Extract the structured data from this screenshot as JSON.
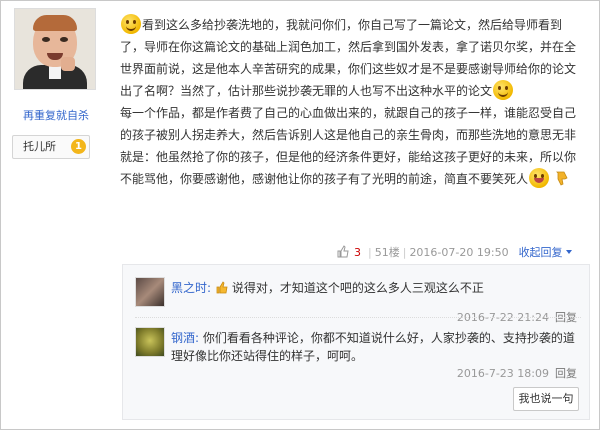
{
  "user": {
    "name": "再重复就自杀",
    "rank": "托儿所",
    "level": "1"
  },
  "post": {
    "paragraph1": "看到这么多给抄袭洗地的，我就问你们，你自己写了一篇论文，然后给导师看到了，导师在你这篇论文的基础上润色加工，然后拿到国外发表，拿了诺贝尔奖，并在全世界面前说，这是他本人辛苦研究的成果，你们这些奴才是不是要感谢导师给你的论文出了名啊？当然了，估计那些说抄袭无罪的人也写不出这种水平的论文",
    "paragraph2": "每一个作品，都是作者费了自己的心血做出来的，就跟自己的孩子一样，谁能忍受自己的孩子被别人拐走养大，然后告诉别人这是他自己的亲生骨肉，而那些洗地的意思无非就是：他虽然抢了你的孩子，但是他的经济条件更好，能给这孩子更好的未来，所以你不能骂他，你要感谢他，感谢他让你的孩子有了光明的前途，简直不要笑死人"
  },
  "meta": {
    "likes": "3",
    "floor": "51楼",
    "date": "2016-07-20 19:50",
    "reply_label": "收起回复"
  },
  "comments": [
    {
      "user": "黑之时",
      "colon": ":",
      "text": "说得对，才知道这个吧的这么多人三观这么不正",
      "date": "2016-7-22 21:24",
      "reply": "回复",
      "avatar_icon": "user-avatar-icon"
    },
    {
      "user": "钢酒",
      "colon": ":",
      "text": "你们看看各种评论，你都不知道说什么好，人家抄袭的、支持抄袭的道理好像比你还站得住的样子，呵呵。",
      "date": "2016-7-23 18:09",
      "reply": "回复",
      "avatar_icon": "user-avatar-icon"
    }
  ],
  "say_button": "我也说一句",
  "icons": {
    "smiley": "smiley-emoticon-icon",
    "laugh": "laughing-emoticon-icon",
    "thumbdown": "thumbs-down-icon",
    "thumbup": "thumbs-up-icon",
    "like": "like-hand-icon"
  },
  "colors": {
    "link": "#3366cc",
    "like_count": "#cc0000"
  }
}
